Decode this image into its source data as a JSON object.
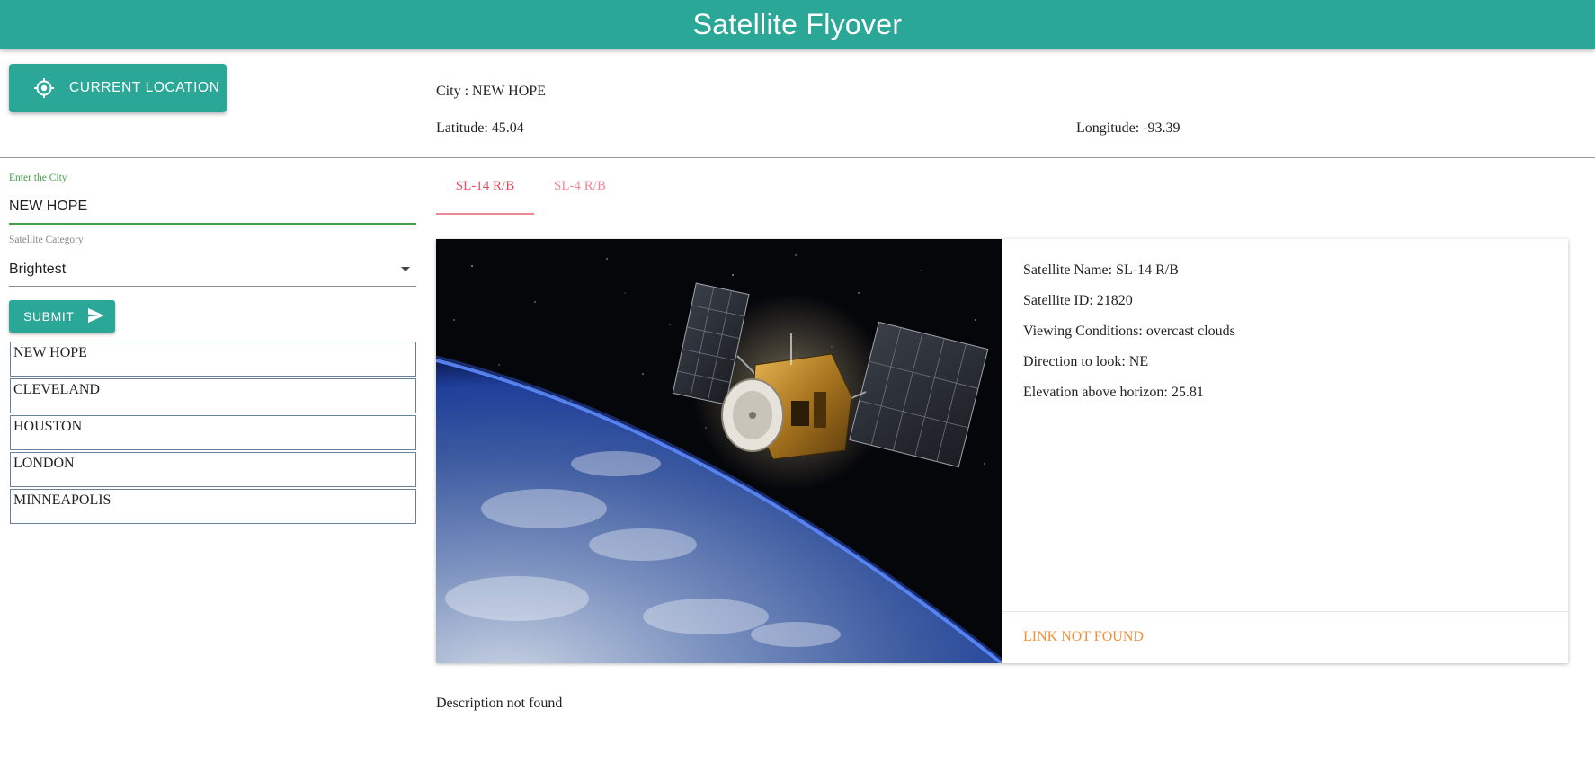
{
  "header": {
    "title": "Satellite Flyover"
  },
  "colors": {
    "primary": "#2ba797",
    "accent_tab": "#e04f5f",
    "link": "#f0913a",
    "input_focus": "#43a047"
  },
  "current_location_button": {
    "label": "CURRENT LOCATION",
    "icon": "gps-crosshair-icon"
  },
  "location_info": {
    "city": "City : NEW HOPE",
    "latitude": "Latitude: 45.04",
    "longitude": "Longitude: -93.39"
  },
  "form": {
    "city_label": "Enter the City",
    "city_value": "NEW HOPE",
    "category_label": "Satellite Category",
    "category_value": "Brightest",
    "submit_label": "SUBMIT",
    "submit_icon": "send-icon"
  },
  "recent_cities": [
    "NEW HOPE",
    "CLEVELAND",
    "HOUSTON",
    "LONDON",
    "MINNEAPOLIS"
  ],
  "tabs": [
    {
      "label": "SL-14 R/B",
      "active": true
    },
    {
      "label": "SL-4 R/B",
      "active": false
    }
  ],
  "satellite_card": {
    "image": "satellite-over-earth-image",
    "name": "Satellite Name: SL-14 R/B",
    "id": "Satellite ID: 21820",
    "viewing": "Viewing Conditions: overcast clouds",
    "direction": "Direction to look: NE",
    "elevation": "Elevation above horizon: 25.81",
    "link_text": "LINK NOT FOUND"
  },
  "description": "Description not found"
}
